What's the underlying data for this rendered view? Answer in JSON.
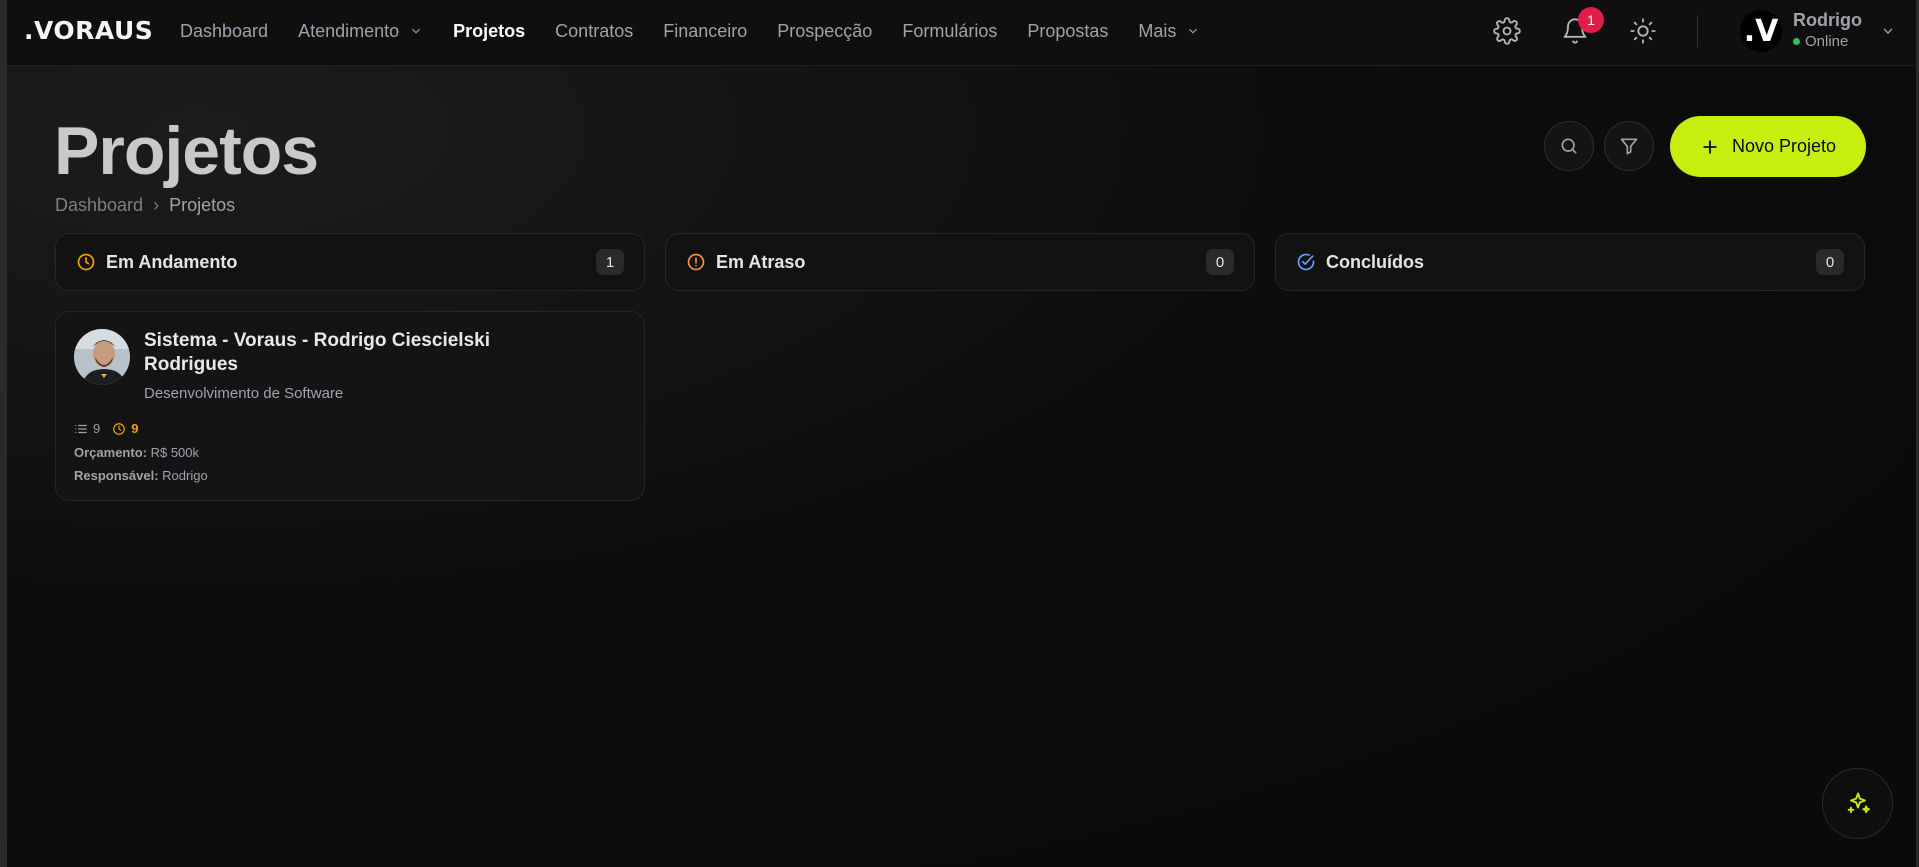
{
  "app": {
    "logo": ".VORAUS",
    "nav": [
      {
        "label": "Dashboard",
        "active": false
      },
      {
        "label": "Atendimento",
        "active": false,
        "dropdown": true
      },
      {
        "label": "Projetos",
        "active": true
      },
      {
        "label": "Contratos",
        "active": false
      },
      {
        "label": "Financeiro",
        "active": false
      },
      {
        "label": "Prospecção",
        "active": false
      },
      {
        "label": "Formulários",
        "active": false
      },
      {
        "label": "Propostas",
        "active": false
      },
      {
        "label": "Mais",
        "active": false,
        "dropdown": true
      }
    ],
    "notifications_count": "1",
    "user": {
      "avatar_letter": ".V",
      "name": "Rodrigo",
      "status": "Online"
    }
  },
  "header": {
    "title": "Projetos",
    "breadcrumb": [
      "Dashboard",
      "Projetos"
    ],
    "breadcrumb_sep": "›",
    "new_button_label": "Novo Projeto"
  },
  "columns": [
    {
      "label": "Em Andamento",
      "count": "1",
      "icon": "clock-icon",
      "color": "#f59e0b"
    },
    {
      "label": "Em Atraso",
      "count": "0",
      "icon": "alert-circle-icon",
      "color": "#fb923c"
    },
    {
      "label": "Concluídos",
      "count": "0",
      "icon": "check-circle-icon",
      "color": "#60a5fa"
    }
  ],
  "projects": [
    {
      "title": "Sistema - Voraus - Rodrigo Ciescielski Rodrigues",
      "subtitle": "Desenvolvimento de Software",
      "tasks_count": "9",
      "pending_count": "9",
      "budget_label": "Orçamento:",
      "budget_value": "R$ 500k",
      "owner_label": "Responsável:",
      "owner_value": "Rodrigo"
    }
  ],
  "colors": {
    "accent": "#c6ef0f",
    "badge": "#e11d48",
    "online": "#22c55e"
  }
}
